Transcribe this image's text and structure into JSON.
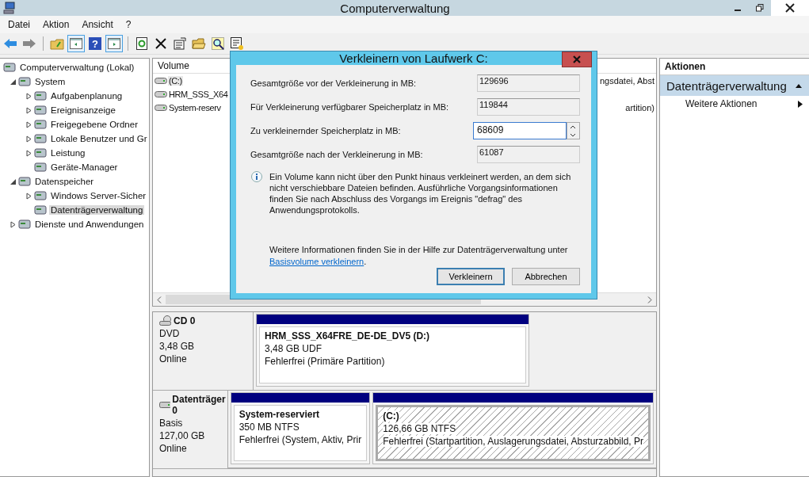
{
  "window": {
    "title": "Computerverwaltung"
  },
  "menu": [
    "Datei",
    "Aktion",
    "Ansicht",
    "?"
  ],
  "toolbar": {
    "help_label": "?"
  },
  "tree": [
    {
      "label": "Computerverwaltung (Lokal)",
      "selected": false,
      "children": [
        {
          "label": "System",
          "expanded": true,
          "selected": false,
          "children": [
            {
              "label": "Aufgabenplanung",
              "expanded": false,
              "selected": false
            },
            {
              "label": "Ereignisanzeige",
              "expanded": false,
              "selected": false
            },
            {
              "label": "Freigegebene Ordner",
              "expanded": false,
              "selected": false
            },
            {
              "label": "Lokale Benutzer und Gr",
              "expanded": false,
              "selected": false
            },
            {
              "label": "Leistung",
              "expanded": false,
              "selected": false
            },
            {
              "label": "Geräte-Manager",
              "selected": false
            }
          ]
        },
        {
          "label": "Datenspeicher",
          "expanded": true,
          "selected": false,
          "children": [
            {
              "label": "Windows Server-Sicher",
              "expanded": false,
              "selected": false
            },
            {
              "label": "Datenträgerverwaltung",
              "selected": true
            }
          ]
        },
        {
          "label": "Dienste und Anwendungen",
          "expanded": false,
          "selected": false
        }
      ]
    }
  ],
  "volume_list": {
    "column_1": "Volume",
    "rows": [
      {
        "name": "(C:)",
        "tail": "ngsdatei, Abst",
        "selected": true
      },
      {
        "name": "HRM_SSS_X64",
        "selected": false
      },
      {
        "name": "System-reserv",
        "tail": "artition)",
        "selected": false
      }
    ]
  },
  "disks": [
    {
      "kind": "dvd",
      "name": "CD 0",
      "type": "DVD",
      "size": "3,48 GB",
      "status": "Online",
      "partitions": [
        {
          "name": "HRM_SSS_X64FRE_DE-DE_DV5  (D:)",
          "size": "3,48 GB UDF",
          "status": "Fehlerfrei (Primäre Partition)",
          "selected": false
        }
      ]
    },
    {
      "kind": "disk",
      "name": "Datenträger 0",
      "type": "Basis",
      "size": "127,00 GB",
      "status": "Online",
      "partitions": [
        {
          "name": "System-reserviert",
          "size": "350 MB NTFS",
          "status": "Fehlerfrei (System, Aktiv, Prir",
          "selected": false
        },
        {
          "name": "(C:)",
          "size": "126,66 GB NTFS",
          "status": "Fehlerfrei (Startpartition, Auslagerungsdatei, Absturzabbild, Pr",
          "selected": true
        }
      ]
    }
  ],
  "actions": {
    "title": "Aktionen",
    "section": {
      "label": "Datenträgerverwaltung",
      "expanded": true
    },
    "items": [
      "Weitere Aktionen"
    ]
  },
  "dialog": {
    "title": "Verkleinern von Laufwerk C:",
    "fields": [
      {
        "kind": "readonly",
        "label": "Gesamtgröße vor der Verkleinerung in MB:",
        "value": "129696"
      },
      {
        "kind": "readonly",
        "label": "Für Verkleinerung verfügbarer Speicherplatz in MB:",
        "value": "119844"
      },
      {
        "kind": "spin",
        "label": "Zu verkleinernder Speicherplatz in MB:",
        "value": "68609"
      },
      {
        "kind": "readonly",
        "label": "Gesamtgröße nach der Verkleinerung in MB:",
        "value": "61087"
      }
    ],
    "info": "Ein Volume kann nicht über den Punkt hinaus verkleinert werden, an dem sich nicht verschiebbare Dateien befinden. Ausführliche Vorgangsinformationen finden Sie nach Abschluss des Vorgangs im Ereignis \"defrag\" des Anwendungsprotokolls.",
    "help_text": "Weitere Informationen finden Sie in der Hilfe zur Datenträgerverwaltung unter",
    "help_link": "Basisvolume verkleinern",
    "help_after": ".",
    "buttons": [
      {
        "label": "Verkleinern",
        "default": true
      },
      {
        "label": "Abbrechen",
        "default": false
      }
    ]
  }
}
